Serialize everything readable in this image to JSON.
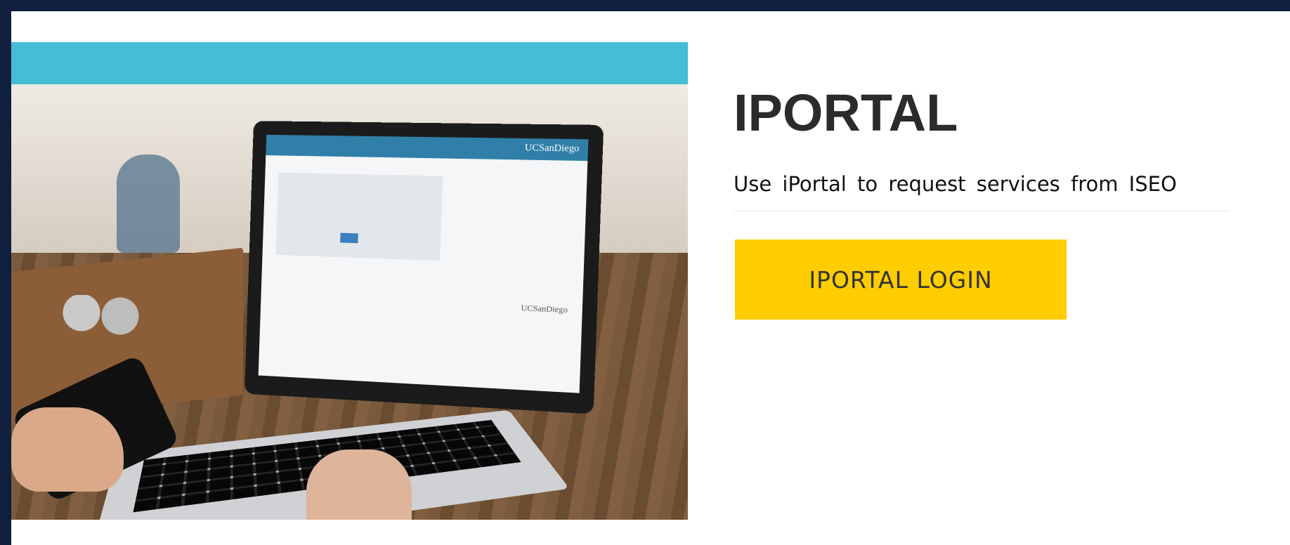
{
  "hero": {
    "image_alt": "Laptop showing UC San Diego Single Sign-On page",
    "laptop_screen": {
      "header_logo": "UCSanDiego",
      "footer_logo": "UCSanDiego"
    }
  },
  "content": {
    "title": "IPORTAL",
    "subtitle": "Use iPortal to request services from ISEO",
    "login_button": "IPORTAL LOGIN"
  },
  "colors": {
    "background": "#0f1f3d",
    "hero_band": "#46bdd6",
    "button": "#ffcd00",
    "title_text": "#2b2b2b"
  }
}
